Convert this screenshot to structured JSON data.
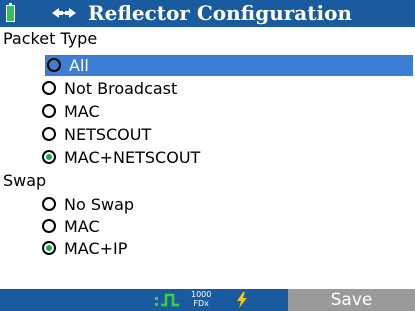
{
  "header": {
    "title": "Reflector Configuration",
    "battery_icon": "battery-icon",
    "link_icon": "link-arrows-icon"
  },
  "packet_type": {
    "label": "Packet Type",
    "options": [
      {
        "label": "All",
        "checked": false,
        "selected": true
      },
      {
        "label": "Not Broadcast",
        "checked": false,
        "selected": false
      },
      {
        "label": "MAC",
        "checked": false,
        "selected": false
      },
      {
        "label": "NETSCOUT",
        "checked": false,
        "selected": false
      },
      {
        "label": "MAC+NETSCOUT",
        "checked": true,
        "selected": false
      }
    ]
  },
  "swap": {
    "label": "Swap",
    "options": [
      {
        "label": "No Swap",
        "checked": false
      },
      {
        "label": "MAC",
        "checked": false
      },
      {
        "label": "MAC+IP",
        "checked": true
      }
    ]
  },
  "status": {
    "speed_top": "1000",
    "speed_bottom": "FDx",
    "link_pulse_icon": "link-pulse-icon",
    "power_icon": "lightning-icon",
    "save_label": "Save"
  },
  "colors": {
    "bar": "#1a5a9e",
    "selected_row": "#3b7fd4",
    "radio_checked": "#1ea94f",
    "save_button": "#9a9a9a",
    "power_bolt": "#f2c413",
    "link_pulse": "#39d13a"
  }
}
